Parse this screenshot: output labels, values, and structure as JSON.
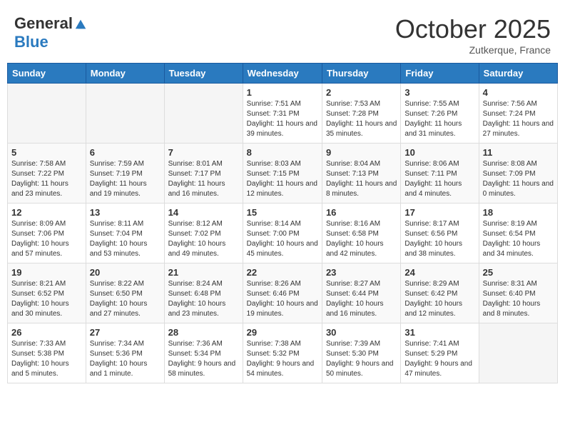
{
  "header": {
    "logo_general": "General",
    "logo_blue": "Blue",
    "month_title": "October 2025",
    "location": "Zutkerque, France"
  },
  "weekdays": [
    "Sunday",
    "Monday",
    "Tuesday",
    "Wednesday",
    "Thursday",
    "Friday",
    "Saturday"
  ],
  "weeks": [
    [
      {
        "day": "",
        "info": ""
      },
      {
        "day": "",
        "info": ""
      },
      {
        "day": "",
        "info": ""
      },
      {
        "day": "1",
        "info": "Sunrise: 7:51 AM\nSunset: 7:31 PM\nDaylight: 11 hours and 39 minutes."
      },
      {
        "day": "2",
        "info": "Sunrise: 7:53 AM\nSunset: 7:28 PM\nDaylight: 11 hours and 35 minutes."
      },
      {
        "day": "3",
        "info": "Sunrise: 7:55 AM\nSunset: 7:26 PM\nDaylight: 11 hours and 31 minutes."
      },
      {
        "day": "4",
        "info": "Sunrise: 7:56 AM\nSunset: 7:24 PM\nDaylight: 11 hours and 27 minutes."
      }
    ],
    [
      {
        "day": "5",
        "info": "Sunrise: 7:58 AM\nSunset: 7:22 PM\nDaylight: 11 hours and 23 minutes."
      },
      {
        "day": "6",
        "info": "Sunrise: 7:59 AM\nSunset: 7:19 PM\nDaylight: 11 hours and 19 minutes."
      },
      {
        "day": "7",
        "info": "Sunrise: 8:01 AM\nSunset: 7:17 PM\nDaylight: 11 hours and 16 minutes."
      },
      {
        "day": "8",
        "info": "Sunrise: 8:03 AM\nSunset: 7:15 PM\nDaylight: 11 hours and 12 minutes."
      },
      {
        "day": "9",
        "info": "Sunrise: 8:04 AM\nSunset: 7:13 PM\nDaylight: 11 hours and 8 minutes."
      },
      {
        "day": "10",
        "info": "Sunrise: 8:06 AM\nSunset: 7:11 PM\nDaylight: 11 hours and 4 minutes."
      },
      {
        "day": "11",
        "info": "Sunrise: 8:08 AM\nSunset: 7:09 PM\nDaylight: 11 hours and 0 minutes."
      }
    ],
    [
      {
        "day": "12",
        "info": "Sunrise: 8:09 AM\nSunset: 7:06 PM\nDaylight: 10 hours and 57 minutes."
      },
      {
        "day": "13",
        "info": "Sunrise: 8:11 AM\nSunset: 7:04 PM\nDaylight: 10 hours and 53 minutes."
      },
      {
        "day": "14",
        "info": "Sunrise: 8:12 AM\nSunset: 7:02 PM\nDaylight: 10 hours and 49 minutes."
      },
      {
        "day": "15",
        "info": "Sunrise: 8:14 AM\nSunset: 7:00 PM\nDaylight: 10 hours and 45 minutes."
      },
      {
        "day": "16",
        "info": "Sunrise: 8:16 AM\nSunset: 6:58 PM\nDaylight: 10 hours and 42 minutes."
      },
      {
        "day": "17",
        "info": "Sunrise: 8:17 AM\nSunset: 6:56 PM\nDaylight: 10 hours and 38 minutes."
      },
      {
        "day": "18",
        "info": "Sunrise: 8:19 AM\nSunset: 6:54 PM\nDaylight: 10 hours and 34 minutes."
      }
    ],
    [
      {
        "day": "19",
        "info": "Sunrise: 8:21 AM\nSunset: 6:52 PM\nDaylight: 10 hours and 30 minutes."
      },
      {
        "day": "20",
        "info": "Sunrise: 8:22 AM\nSunset: 6:50 PM\nDaylight: 10 hours and 27 minutes."
      },
      {
        "day": "21",
        "info": "Sunrise: 8:24 AM\nSunset: 6:48 PM\nDaylight: 10 hours and 23 minutes."
      },
      {
        "day": "22",
        "info": "Sunrise: 8:26 AM\nSunset: 6:46 PM\nDaylight: 10 hours and 19 minutes."
      },
      {
        "day": "23",
        "info": "Sunrise: 8:27 AM\nSunset: 6:44 PM\nDaylight: 10 hours and 16 minutes."
      },
      {
        "day": "24",
        "info": "Sunrise: 8:29 AM\nSunset: 6:42 PM\nDaylight: 10 hours and 12 minutes."
      },
      {
        "day": "25",
        "info": "Sunrise: 8:31 AM\nSunset: 6:40 PM\nDaylight: 10 hours and 8 minutes."
      }
    ],
    [
      {
        "day": "26",
        "info": "Sunrise: 7:33 AM\nSunset: 5:38 PM\nDaylight: 10 hours and 5 minutes."
      },
      {
        "day": "27",
        "info": "Sunrise: 7:34 AM\nSunset: 5:36 PM\nDaylight: 10 hours and 1 minute."
      },
      {
        "day": "28",
        "info": "Sunrise: 7:36 AM\nSunset: 5:34 PM\nDaylight: 9 hours and 58 minutes."
      },
      {
        "day": "29",
        "info": "Sunrise: 7:38 AM\nSunset: 5:32 PM\nDaylight: 9 hours and 54 minutes."
      },
      {
        "day": "30",
        "info": "Sunrise: 7:39 AM\nSunset: 5:30 PM\nDaylight: 9 hours and 50 minutes."
      },
      {
        "day": "31",
        "info": "Sunrise: 7:41 AM\nSunset: 5:29 PM\nDaylight: 9 hours and 47 minutes."
      },
      {
        "day": "",
        "info": ""
      }
    ]
  ]
}
